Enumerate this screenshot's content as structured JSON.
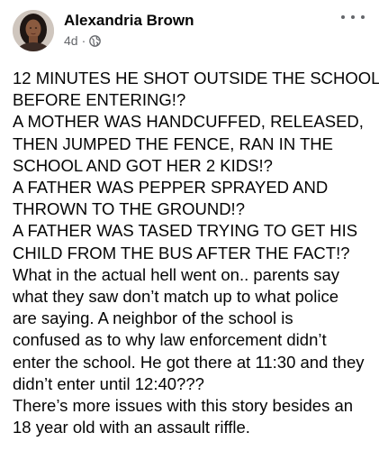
{
  "post": {
    "author": "Alexandria Brown",
    "time": "4d",
    "separator": "·",
    "visibility_icon": "globe-icon",
    "more_icon": "more-options-icon",
    "lines": [
      "12 MINUTES HE SHOT OUTSIDE THE SCHOOL",
      "BEFORE ENTERING!?",
      "A MOTHER WAS HANDCUFFED, RELEASED,",
      "THEN JUMPED THE FENCE, RAN IN THE",
      "SCHOOL AND GOT HER 2 KIDS!?",
      "A FATHER WAS PEPPER SPRAYED AND",
      "THROWN TO THE GROUND!?",
      "A FATHER WAS TASED TRYING TO GET HIS",
      "CHILD FROM THE BUS AFTER THE FACT!?",
      "What in the actual hell went on.. parents say",
      "what they saw don’t match up to what police",
      "are saying. A neighbor of the school is",
      "confused as to why law enforcement didn’t",
      "enter the school. He got there at 11:30 and they",
      "didn’t enter until 12:40???",
      "There’s more issues with this story besides an",
      "18 year old with an assault riffle."
    ]
  },
  "colors": {
    "text": "#050505",
    "secondary": "#65676b",
    "background": "#ffffff"
  }
}
